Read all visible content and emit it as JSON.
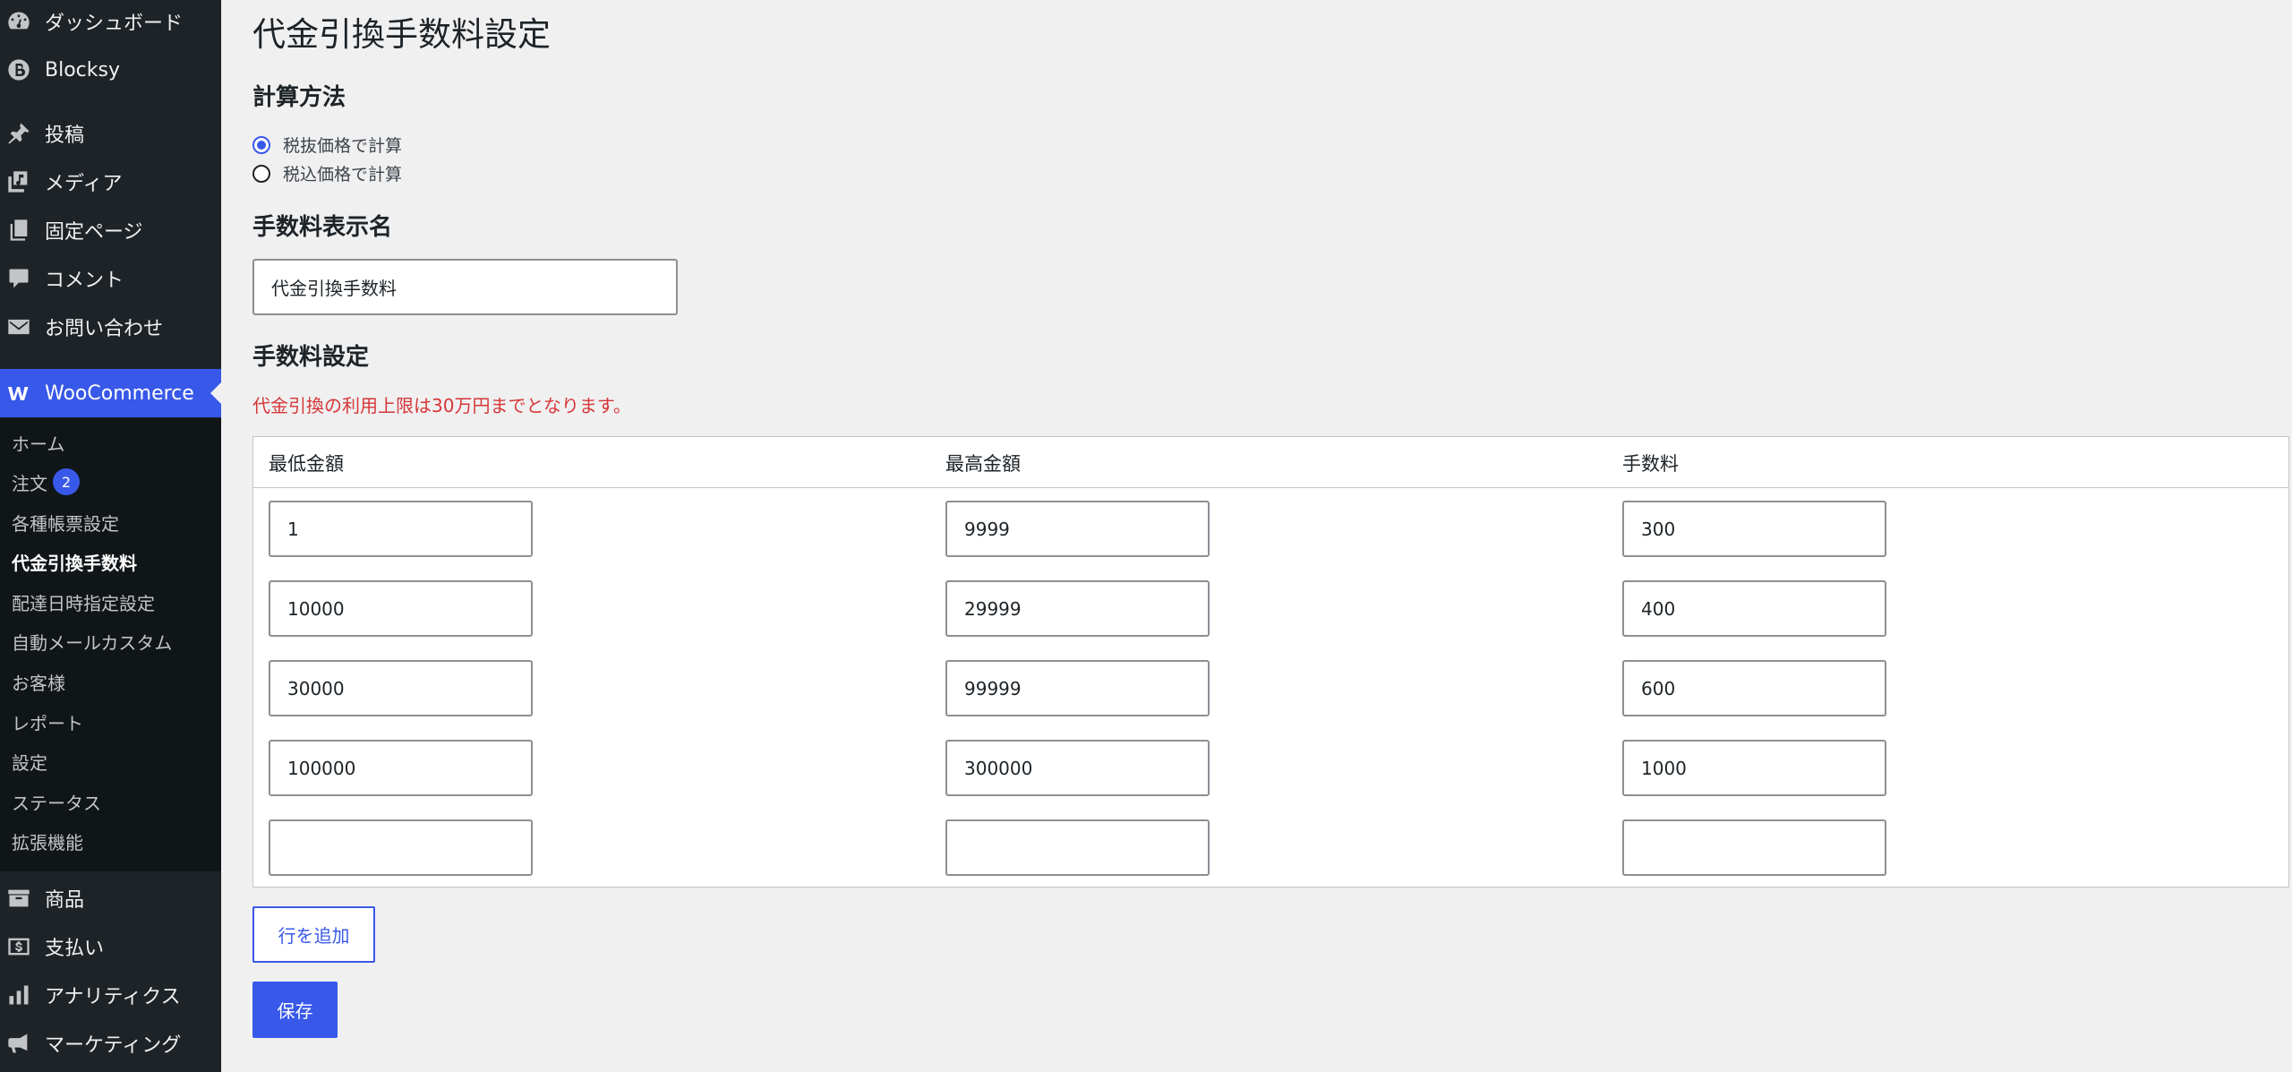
{
  "sidebar": {
    "items": [
      {
        "label": "ダッシュボード",
        "icon": "dashboard-icon"
      },
      {
        "label": "Blocksy",
        "icon": "blocksy-icon"
      },
      {
        "label": "投稿",
        "icon": "pin-icon"
      },
      {
        "label": "メディア",
        "icon": "media-icon"
      },
      {
        "label": "固定ページ",
        "icon": "pages-icon"
      },
      {
        "label": "コメント",
        "icon": "comment-icon"
      },
      {
        "label": "お問い合わせ",
        "icon": "mail-icon"
      },
      {
        "label": "WooCommerce",
        "icon": "woocommerce-icon"
      },
      {
        "label": "商品",
        "icon": "archive-icon"
      },
      {
        "label": "支払い",
        "icon": "payment-icon"
      },
      {
        "label": "アナリティクス",
        "icon": "analytics-icon"
      },
      {
        "label": "マーケティング",
        "icon": "megaphone-icon"
      }
    ],
    "submenu": [
      {
        "label": "ホーム"
      },
      {
        "label": "注文",
        "badge": "2"
      },
      {
        "label": "各種帳票設定"
      },
      {
        "label": "代金引換手数料"
      },
      {
        "label": "配達日時指定設定"
      },
      {
        "label": "自動メールカスタム"
      },
      {
        "label": "お客様"
      },
      {
        "label": "レポート"
      },
      {
        "label": "設定"
      },
      {
        "label": "ステータス"
      },
      {
        "label": "拡張機能"
      }
    ]
  },
  "main": {
    "title": "代金引換手数料設定",
    "calc_method": {
      "heading": "計算方法",
      "options": [
        {
          "label": "税抜価格で計算",
          "checked": true
        },
        {
          "label": "税込価格で計算",
          "checked": false
        }
      ]
    },
    "display_name": {
      "heading": "手数料表示名",
      "value": "代金引換手数料"
    },
    "fee_settings": {
      "heading": "手数料設定",
      "notice": "代金引換の利用上限は30万円までとなります。",
      "columns": [
        "最低金額",
        "最高金額",
        "手数料"
      ],
      "rows": [
        [
          "1",
          "9999",
          "300"
        ],
        [
          "10000",
          "29999",
          "400"
        ],
        [
          "30000",
          "99999",
          "600"
        ],
        [
          "100000",
          "300000",
          "1000"
        ],
        [
          "",
          "",
          ""
        ]
      ]
    },
    "add_row_label": "行を追加",
    "save_label": "保存"
  },
  "colors": {
    "accent": "#3858e9",
    "sidebar_bg": "#1d2327",
    "submenu_bg": "#101517",
    "notice": "#d63638"
  }
}
